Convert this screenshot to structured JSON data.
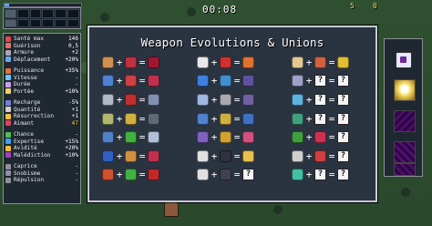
{
  "hud": {
    "timer": "00:08",
    "gold": "5",
    "kills": "0",
    "xp_fraction": 0.06
  },
  "weapon_slots": {
    "filled": [
      true,
      false,
      false,
      false,
      false,
      false,
      true,
      false,
      false,
      false,
      false,
      false
    ]
  },
  "stats": [
    [
      {
        "label": "Santé max",
        "value": "146",
        "color": "#e04848",
        "icon": "heart-icon"
      },
      {
        "label": "Guérison",
        "value": "0,5",
        "color": "#e07070",
        "icon": "heal-icon"
      },
      {
        "label": "Armure",
        "value": "+2",
        "color": "#a8a8b0",
        "icon": "armor-icon"
      },
      {
        "label": "Déplacement",
        "value": "+20%",
        "color": "#68a8e8",
        "icon": "wing-icon"
      }
    ],
    [
      {
        "label": "Puissance",
        "value": "+35%",
        "color": "#e87030",
        "icon": "fire-icon"
      },
      {
        "label": "Vitesse",
        "value": "-",
        "color": "#68c8f0",
        "icon": "speed-icon"
      },
      {
        "label": "Durée",
        "value": "-",
        "color": "#c8a0f0",
        "icon": "hourglass-icon"
      },
      {
        "label": "Portée",
        "value": "+10%",
        "color": "#f0d060",
        "icon": "range-icon"
      }
    ],
    [
      {
        "label": "Recharge",
        "value": "-5%",
        "color": "#7080e0",
        "icon": "cooldown-icon"
      },
      {
        "label": "Quantité",
        "value": "+1",
        "color": "#d0d0d0",
        "icon": "amount-icon"
      },
      {
        "label": "Résurrection",
        "value": "+1",
        "color": "#f0c040",
        "icon": "revival-icon"
      },
      {
        "label": "Aimant",
        "value": "47",
        "color": "#e04060",
        "icon": "magnet-icon",
        "gold": true
      }
    ],
    [
      {
        "label": "Chance",
        "value": "-",
        "color": "#50c050",
        "icon": "clover-icon"
      },
      {
        "label": "Expertise",
        "value": "+15%",
        "color": "#40a0f0",
        "icon": "crown-icon"
      },
      {
        "label": "Avidité",
        "value": "+20%",
        "color": "#f0c030",
        "icon": "coin-icon"
      },
      {
        "label": "Malédiction",
        "value": "+10%",
        "color": "#a040c0",
        "icon": "skull-icon"
      }
    ],
    [
      {
        "label": "Caprice",
        "value": "-",
        "color": "#9090a0",
        "icon": "reroll-icon"
      },
      {
        "label": "Snobisme",
        "value": "-",
        "color": "#9090a0",
        "icon": "skip-icon"
      },
      {
        "label": "Répulsion",
        "value": "-",
        "color": "#9090a0",
        "icon": "banish-icon"
      }
    ]
  ],
  "modal": {
    "title": "Weapon Evolutions & Unions",
    "columns": [
      [
        {
          "a": {
            "icon": "whip-icon",
            "color": "#d09050"
          },
          "b": {
            "icon": "hollow-heart-icon",
            "color": "#c03040"
          },
          "r": {
            "icon": "bloody-tear-icon",
            "color": "#a01830"
          }
        },
        {
          "a": {
            "icon": "magic-wand-icon",
            "color": "#5080d0"
          },
          "b": {
            "icon": "empty-tome-icon",
            "color": "#d04040"
          },
          "r": {
            "icon": "holy-wand-icon",
            "color": "#c03050"
          }
        },
        {
          "a": {
            "icon": "knife-icon",
            "color": "#b0b8c8"
          },
          "b": {
            "icon": "bracer-icon",
            "color": "#c03030"
          },
          "r": {
            "icon": "thousand-edge-icon",
            "color": "#8090b0"
          }
        },
        {
          "a": {
            "icon": "axe-icon",
            "color": "#b0b870"
          },
          "b": {
            "icon": "candelabrador-icon",
            "color": "#d0b040"
          },
          "r": {
            "icon": "death-spiral-icon",
            "color": "#606878"
          }
        },
        {
          "a": {
            "icon": "cross-icon",
            "color": "#5080c8"
          },
          "b": {
            "icon": "clover-icon",
            "color": "#40b040"
          },
          "r": {
            "icon": "heaven-sword-icon",
            "color": "#b0c0d8"
          }
        },
        {
          "a": {
            "icon": "king-bible-icon",
            "color": "#3060c0"
          },
          "b": {
            "icon": "spellbinder-icon",
            "color": "#d09040"
          },
          "r": {
            "icon": "unholy-vespers-icon",
            "color": "#c03050"
          }
        },
        {
          "a": {
            "icon": "fire-wand-icon",
            "color": "#d05030"
          },
          "b": {
            "icon": "spinach-icon",
            "color": "#40b040"
          },
          "r": {
            "icon": "hellfire-icon",
            "color": "#c02828"
          }
        }
      ],
      [
        {
          "a": {
            "icon": "garlic-icon",
            "color": "#e8e8e8"
          },
          "b": {
            "icon": "pummarola-icon",
            "color": "#d03030"
          },
          "r": {
            "icon": "soul-eater-icon",
            "color": "#e07030"
          }
        },
        {
          "a": {
            "icon": "santa-water-icon",
            "color": "#4080e0"
          },
          "b": {
            "icon": "attractorb-icon",
            "color": "#4090d0"
          },
          "r": {
            "icon": "la-borra-icon",
            "color": "#6050a0"
          }
        },
        {
          "a": {
            "icon": "runetracer-icon",
            "color": "#a0b8e0"
          },
          "b": {
            "icon": "armor-icon",
            "color": "#a8a8b0"
          },
          "r": {
            "icon": "nohs-icon",
            "color": "#7060a0"
          }
        },
        {
          "a": {
            "icon": "lightning-ring-icon",
            "color": "#5080d0"
          },
          "b": {
            "icon": "duplicator-icon",
            "color": "#d0b040"
          },
          "r": {
            "icon": "thunder-loop-icon",
            "color": "#4070c0"
          }
        },
        {
          "a": {
            "icon": "pentagram-icon",
            "color": "#8060c0"
          },
          "b": {
            "icon": "crown-icon",
            "color": "#d0a030"
          },
          "r": {
            "icon": "gorgeous-moon-icon",
            "color": "#d05080"
          }
        },
        {
          "a": {
            "icon": "peachone-icon",
            "color": "#e0e0e0"
          },
          "b": {
            "icon": "ebony-wings-icon",
            "color": "#303040"
          },
          "r": {
            "icon": "vandalier-icon",
            "color": "#e8c050"
          }
        },
        {
          "a": {
            "icon": "phiera-icon",
            "color": "#e0e0e0"
          },
          "b": {
            "icon": "eight-sparrow-icon",
            "color": "#404050"
          },
          "r": {
            "icon": "question-mark-icon",
            "unknown": true
          }
        }
      ],
      [
        {
          "a": {
            "icon": "gatti-amari-icon",
            "color": "#e0c890"
          },
          "b": {
            "icon": "stone-mask-icon",
            "color": "#d06040"
          },
          "r": {
            "icon": "vicious-hunger-icon",
            "color": "#e0c030"
          }
        },
        {
          "a": {
            "icon": "song-of-mana-icon",
            "color": "#a0a0c8"
          },
          "b": {
            "icon": "question-mark-icon",
            "unknown": true
          },
          "r": {
            "icon": "question-mark-icon",
            "unknown": true
          }
        },
        {
          "a": {
            "icon": "shadow-pinion-icon",
            "color": "#60b0e0"
          },
          "b": {
            "icon": "question-mark-icon",
            "unknown": true
          },
          "r": {
            "icon": "question-mark-icon",
            "unknown": true
          }
        },
        {
          "a": {
            "icon": "clock-lancet-icon",
            "color": "#40a080"
          },
          "b": {
            "icon": "question-mark-icon",
            "unknown": true
          },
          "r": {
            "icon": "question-mark-icon",
            "unknown": true
          }
        },
        {
          "a": {
            "icon": "laurel-icon",
            "color": "#40a040"
          },
          "b": {
            "icon": "metaglio-icon",
            "color": "#d03050"
          },
          "r": {
            "icon": "question-mark-icon",
            "unknown": true
          }
        },
        {
          "a": {
            "icon": "bone-icon",
            "color": "#d0d0d0"
          },
          "b": {
            "icon": "cherry-bomb-icon",
            "color": "#d04040"
          },
          "r": {
            "icon": "question-mark-icon",
            "unknown": true
          }
        },
        {
          "a": {
            "icon": "celestial-dusting-icon",
            "color": "#40c0a0"
          },
          "b": {
            "icon": "question-mark-icon",
            "unknown": true
          },
          "r": {
            "icon": "question-mark-icon",
            "unknown": true
          }
        }
      ]
    ]
  },
  "items": {
    "top": {
      "icon": "treasure-chest-icon"
    },
    "cards": [
      "sunburst-card",
      "purple-card",
      "purple-card",
      "purple-card"
    ]
  },
  "glyphs": {
    "plus": "+",
    "equals": "=",
    "unknown": "?"
  }
}
